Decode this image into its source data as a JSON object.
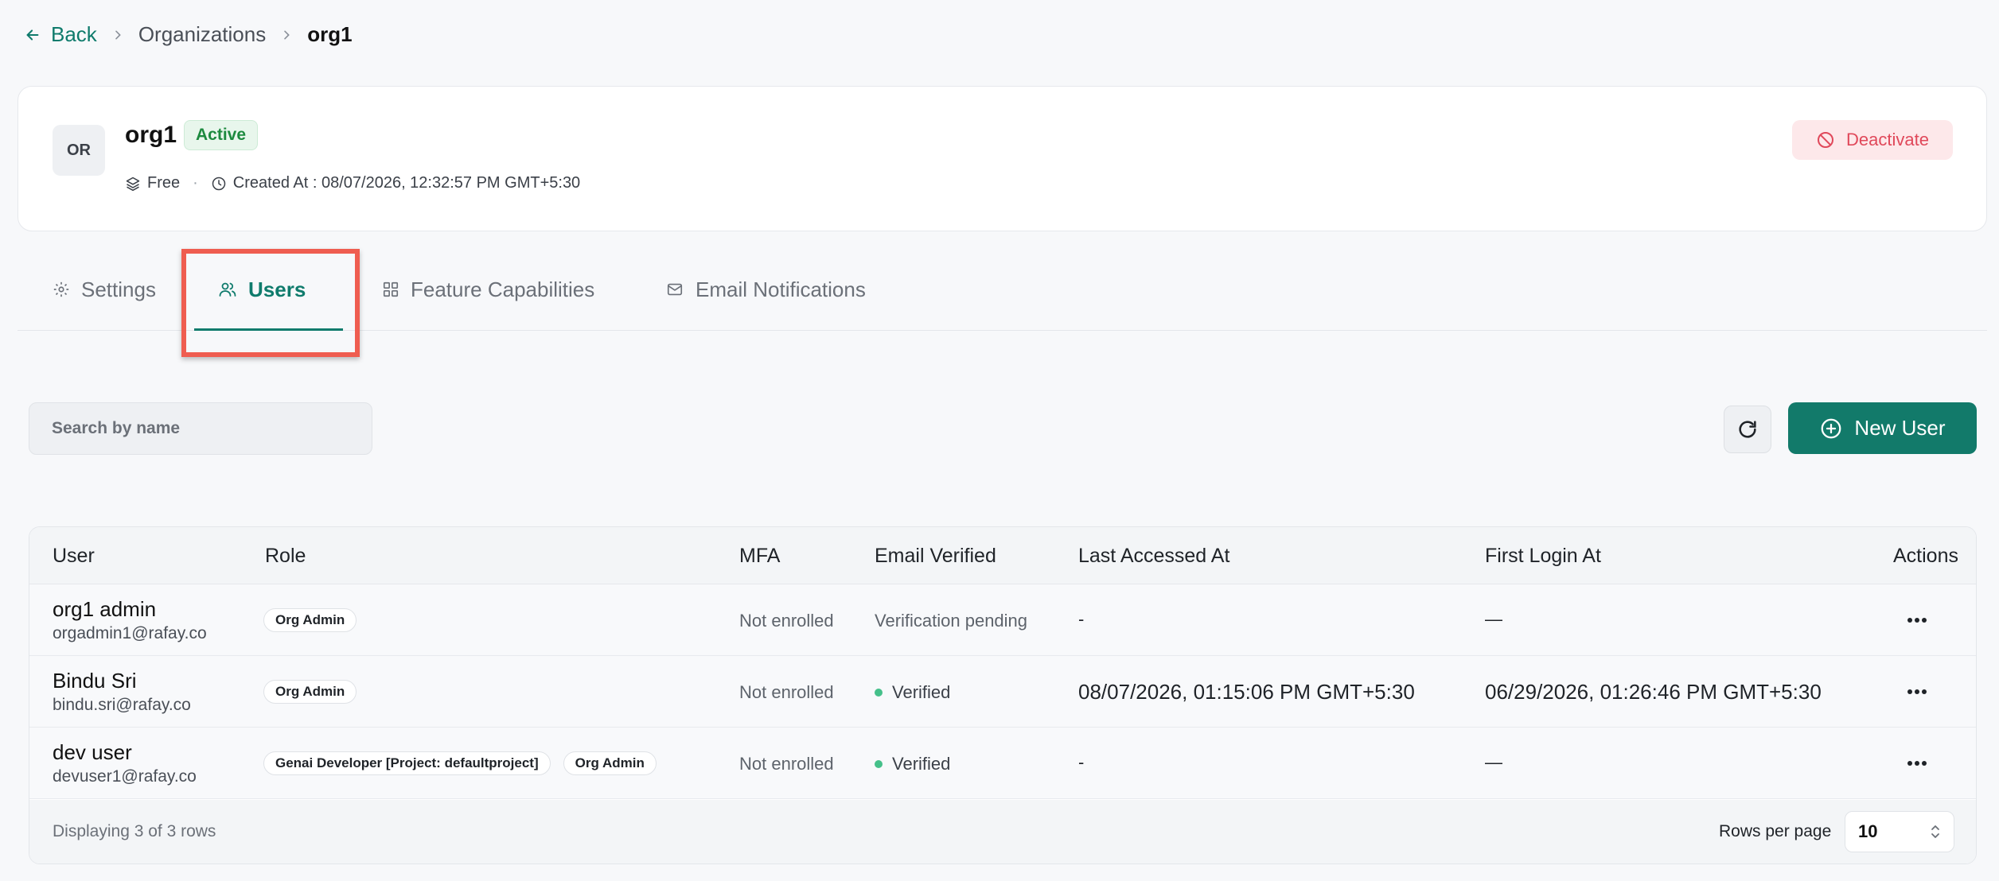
{
  "breadcrumb": {
    "back": "Back",
    "level1": "Organizations",
    "current": "org1"
  },
  "org": {
    "initials": "OR",
    "name": "org1",
    "status": "Active",
    "plan": "Free",
    "created": "Created At : 08/07/2026, 12:32:57 PM GMT+5:30",
    "deactivate_label": "Deactivate"
  },
  "tabs": [
    {
      "label": "Settings",
      "icon": "gear-icon"
    },
    {
      "label": "Users",
      "icon": "users-icon"
    },
    {
      "label": "Feature Capabilities",
      "icon": "grid-icon"
    },
    {
      "label": "Email Notifications",
      "icon": "mail-icon"
    }
  ],
  "toolbar": {
    "search_placeholder": "Search by name",
    "new_user_label": "New User"
  },
  "table": {
    "columns": [
      "User",
      "Role",
      "MFA",
      "Email Verified",
      "Last Accessed At",
      "First Login At",
      "Actions"
    ],
    "rows": [
      {
        "name": "org1 admin",
        "email": "orgadmin1@rafay.co",
        "roles": [
          "Org Admin"
        ],
        "mfa": "Not enrolled",
        "email_verified": "Verification pending",
        "last_accessed": "-",
        "first_login": "—"
      },
      {
        "name": "Bindu Sri",
        "email": "bindu.sri@rafay.co",
        "roles": [
          "Org Admin"
        ],
        "mfa": "Not enrolled",
        "email_verified": "Verified",
        "last_accessed": "08/07/2026, 01:15:06 PM GMT+5:30",
        "first_login": "06/29/2026, 01:26:46 PM GMT+5:30"
      },
      {
        "name": "dev user",
        "email": "devuser1@rafay.co",
        "roles": [
          "Genai Developer [Project: defaultproject]",
          "Org Admin"
        ],
        "mfa": "Not enrolled",
        "email_verified": "Verified",
        "last_accessed": "-",
        "first_login": "—"
      }
    ],
    "footer_text": "Displaying 3 of 3 rows",
    "rows_per_page_label": "Rows per page",
    "rows_per_page_value": "10"
  },
  "colors": {
    "accent": "#0f7b6c",
    "primary_button": "#127a6a",
    "danger": "#e0485a",
    "highlight": "#ef5d50",
    "active_badge": "#1d8a3f"
  }
}
